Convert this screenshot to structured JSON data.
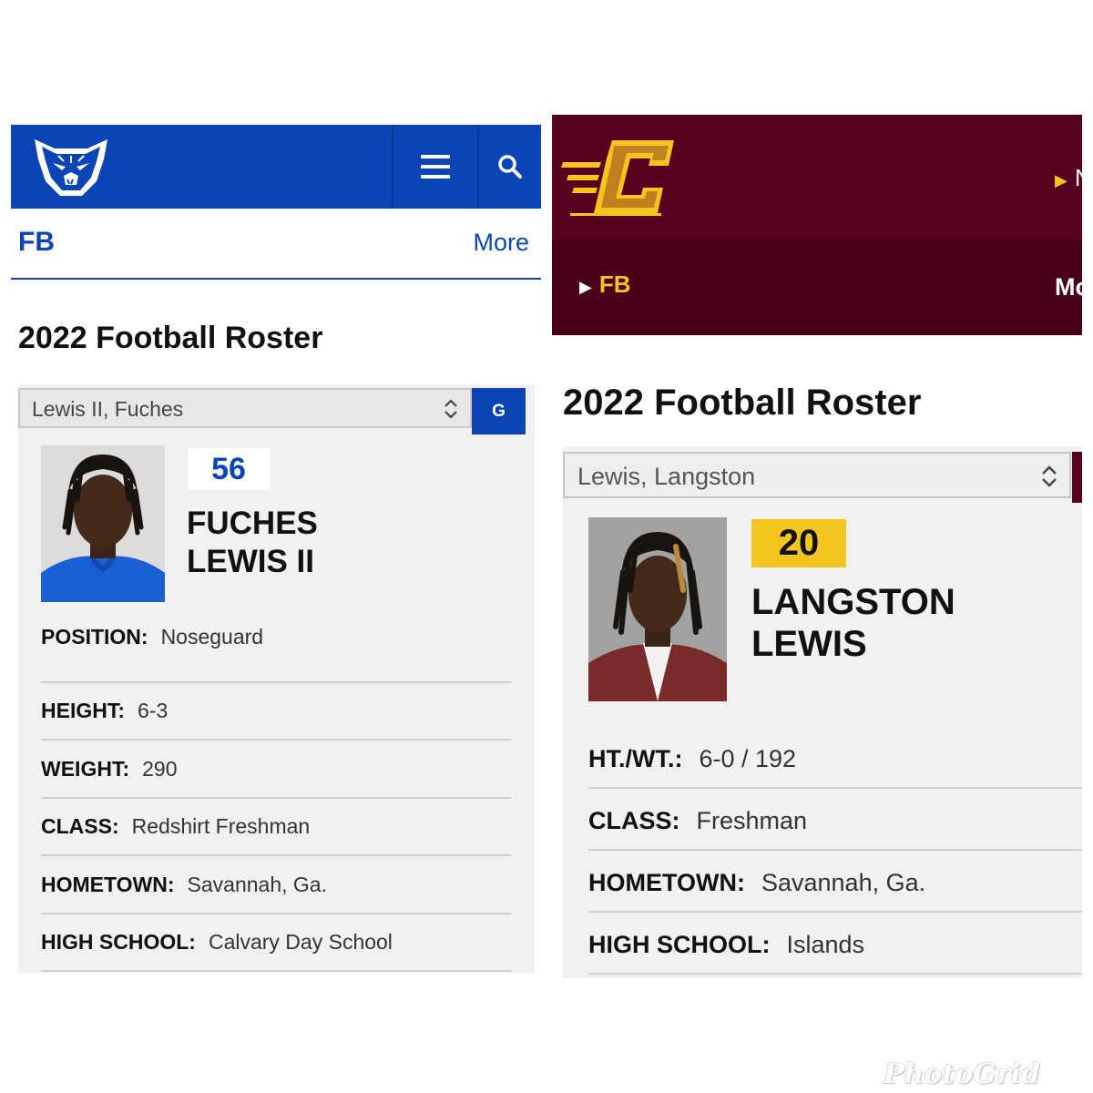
{
  "left": {
    "header": {
      "logo_icon": "panther-head-logo",
      "menu_icon": "hamburger-menu-icon",
      "search_icon": "search-icon",
      "brand_color": "#0b44b4"
    },
    "subnav": {
      "sport": "FB",
      "more": "More"
    },
    "title": "2022 Football Roster",
    "player_select": {
      "value": "Lewis II, Fuches",
      "go_label": "G"
    },
    "player": {
      "number": "56",
      "name_line1": "FUCHES",
      "name_line2": "LEWIS II",
      "photo": "player-headshot"
    },
    "details": [
      {
        "label": "POSITION:",
        "value": "Noseguard"
      },
      {
        "label": "HEIGHT:",
        "value": "6-3"
      },
      {
        "label": "WEIGHT:",
        "value": "290"
      },
      {
        "label": "CLASS:",
        "value": "Redshirt Freshman"
      },
      {
        "label": "HOMETOWN:",
        "value": "Savannah, Ga."
      },
      {
        "label": "HIGH SCHOOL:",
        "value": "Calvary Day School"
      }
    ]
  },
  "right": {
    "header": {
      "logo_icon": "flying-c-logo",
      "nav_partial": "N",
      "brand_color": "#570020",
      "accent_color": "#f5c51f"
    },
    "subnav": {
      "sport": "FB",
      "more": "Mo"
    },
    "title": "2022 Football Roster",
    "player_select": {
      "value": "Lewis, Langston"
    },
    "player": {
      "number": "20",
      "name_line1": "LANGSTON",
      "name_line2": "LEWIS",
      "photo": "player-headshot"
    },
    "details": [
      {
        "label": "HT./WT.:",
        "value": "6-0 / 192"
      },
      {
        "label": "CLASS:",
        "value": "Freshman"
      },
      {
        "label": "HOMETOWN:",
        "value": "Savannah, Ga."
      },
      {
        "label": "HIGH SCHOOL:",
        "value": "Islands"
      }
    ]
  },
  "watermark": "PhotoGrid"
}
